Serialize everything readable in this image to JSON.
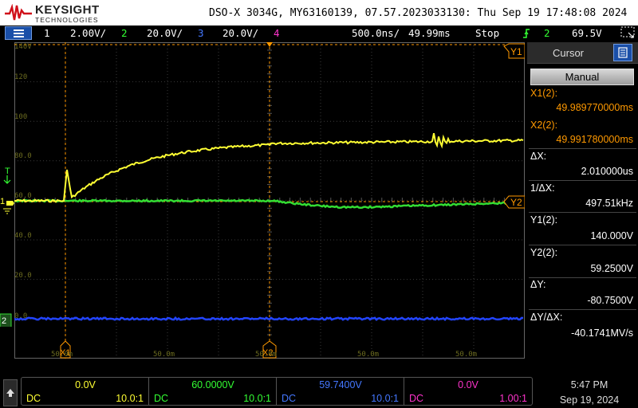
{
  "header": {
    "brand": "KEYSIGHT",
    "brand_sub": "TECHNOLOGIES",
    "title": "DSO-X 3034G, MY63160139, 07.57.2023033130: Thu Sep 19 17:48:08 2024"
  },
  "channel_bar": {
    "ch1_num": "1",
    "ch1_scale": "2.00V/",
    "ch2_num": "2",
    "ch2_scale": "20.0V/",
    "ch3_num": "3",
    "ch3_scale": "20.0V/",
    "ch4_num": "4",
    "timebase": "500.0ns/",
    "delay": "49.99ms",
    "run_state": "Stop",
    "trigger_channel": "2",
    "trigger_level": "69.5V"
  },
  "grid": {
    "y_labels": [
      "140V",
      "120",
      "100",
      "80.0",
      "60.0",
      "40.0",
      "20.0",
      "0.0"
    ],
    "x_labels": [
      "50.0m",
      "50.0m",
      "50.0m",
      "50.0m",
      "50.0m"
    ],
    "markers": {
      "x1": "X1",
      "x2": "X2",
      "y1": "Y1",
      "y2": "Y2",
      "trigger": "T",
      "ch1": "1",
      "ch2": "2"
    }
  },
  "cursor_panel": {
    "title": "Cursor",
    "mode": "Manual",
    "x1_label": "X1(2):",
    "x1_value": "49.989770000ms",
    "x2_label": "X2(2):",
    "x2_value": "49.991780000ms",
    "dx_label": "ΔX:",
    "dx_value": "2.010000us",
    "inv_dx_label": "1/ΔX:",
    "inv_dx_value": "497.51kHz",
    "y1_label": "Y1(2):",
    "y1_value": "140.000V",
    "y2_label": "Y2(2):",
    "y2_value": "59.2500V",
    "dy_label": "ΔY:",
    "dy_value": "-80.7500V",
    "dydx_label": "ΔY/ΔX:",
    "dydx_value": "-40.1741MV/s"
  },
  "bottom_bar": {
    "channels": [
      {
        "offset": "0.0V",
        "coupling": "DC",
        "probe": "10.0:1",
        "color": "#ffff33"
      },
      {
        "offset": "60.0000V",
        "coupling": "DC",
        "probe": "10.0:1",
        "color": "#33ff33"
      },
      {
        "offset": "59.7400V",
        "coupling": "DC",
        "probe": "10.0:1",
        "color": "#4477ff"
      },
      {
        "offset": "0.0V",
        "coupling": "DC",
        "probe": "1.00:1",
        "color": "#ff33cc"
      }
    ],
    "time": "5:47 PM",
    "date": "Sep 19, 2024"
  },
  "colors": {
    "ch1": "#ffff33",
    "ch2": "#33dd33",
    "ch3": "#2244ff",
    "ch4": "#ff33cc",
    "cursor": "#ff9900",
    "accent": "#1a4fa8"
  }
}
